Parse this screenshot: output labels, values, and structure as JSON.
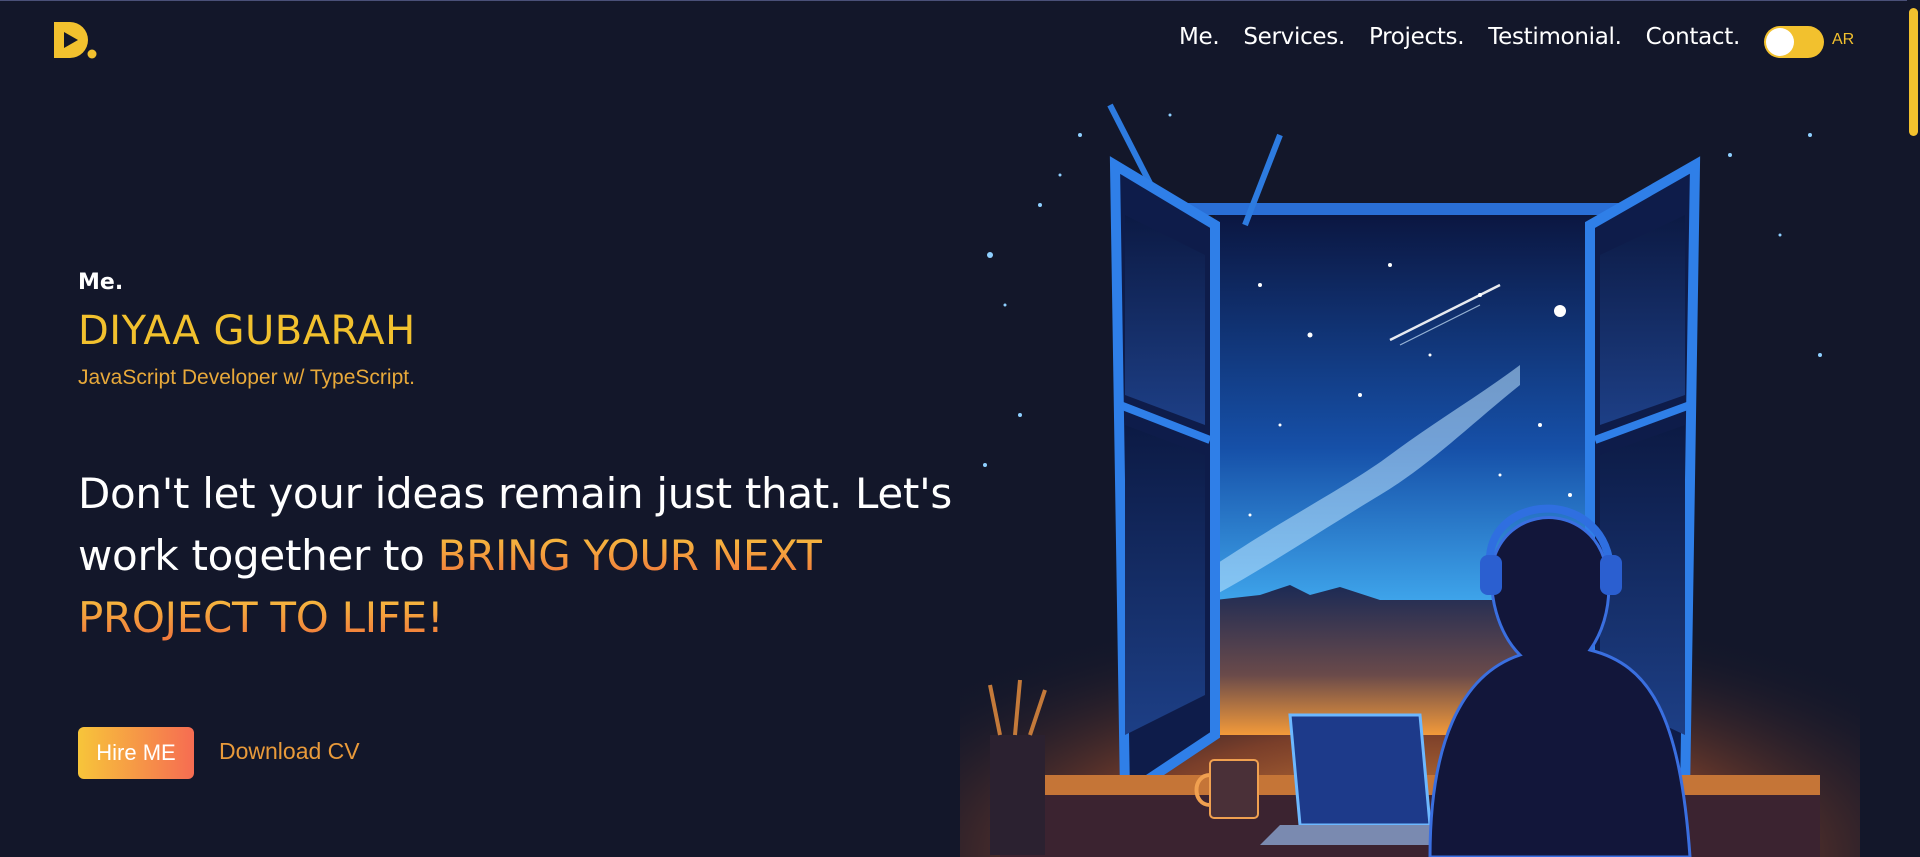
{
  "header": {
    "logo_letter": "D.",
    "nav": [
      "Me.",
      "Services.",
      "Projects.",
      "Testimonial.",
      "Contact."
    ],
    "language_label": "AR"
  },
  "hero": {
    "section_tag": "Me.",
    "name": "DIYAA GUBARAH",
    "role": "JavaScript Developer w/ TypeScript.",
    "headline_plain": "Don't let your ideas remain just that. Let's work together to ",
    "headline_highlight": "BRING YOUR NEXT PROJECT TO LIFE!",
    "hire_button": "Hire ME",
    "download_cv": "Download CV"
  },
  "colors": {
    "background": "#13172a",
    "accent_yellow": "#f2c12e",
    "accent_orange": "#f1743c"
  },
  "icons": {
    "logo": "play-d-logo",
    "illustration": "night-window-illustration"
  }
}
